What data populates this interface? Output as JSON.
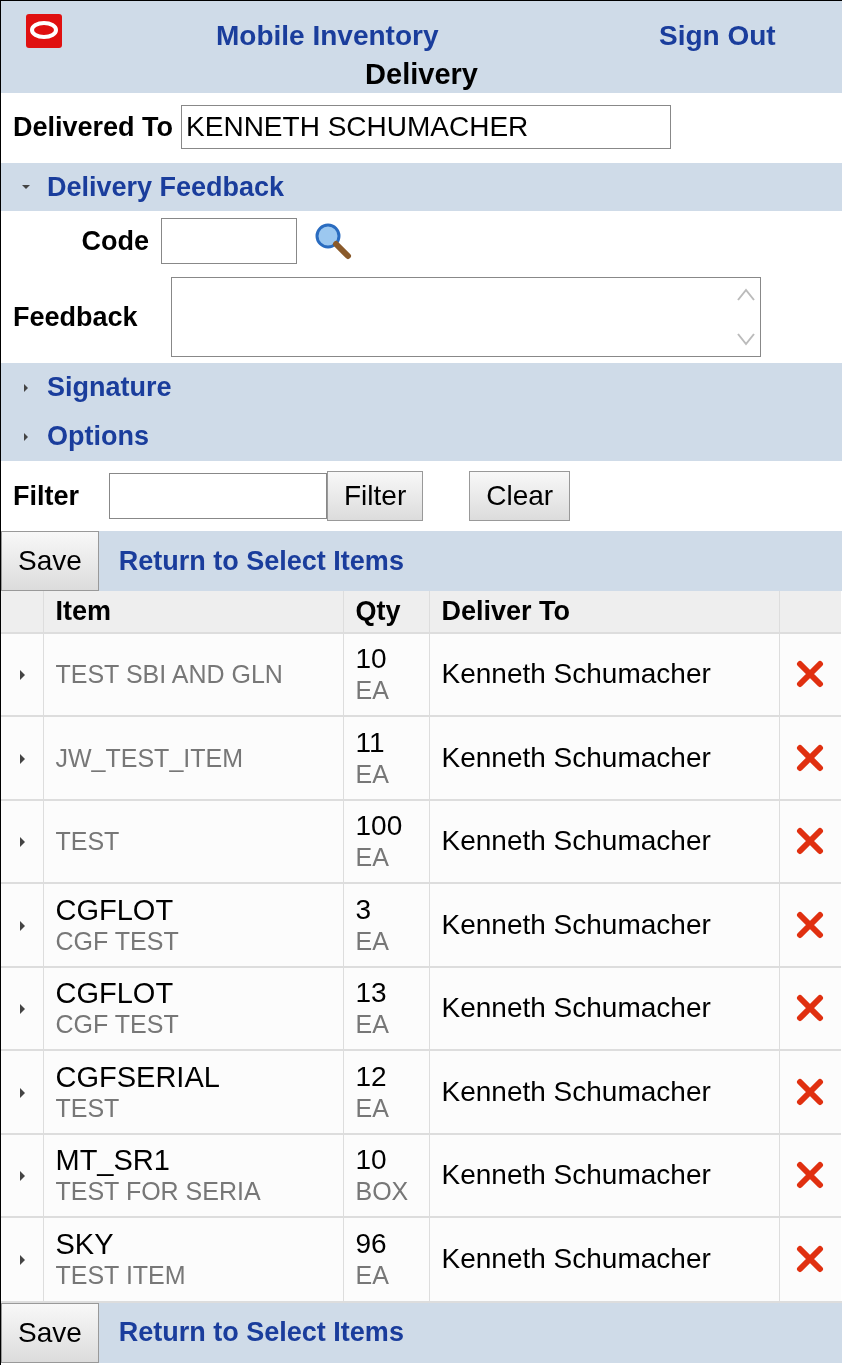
{
  "header": {
    "app_title": "Mobile Inventory",
    "sign_out": "Sign Out",
    "page_title": "Delivery"
  },
  "delivered_to": {
    "label": "Delivered To",
    "value": "KENNETH SCHUMACHER"
  },
  "sections": [
    {
      "title": "Delivery Feedback",
      "expanded": true,
      "fields": [
        {
          "kind": "lookup",
          "label": "Code"
        },
        {
          "kind": "textarea",
          "label": "Feedback"
        }
      ]
    },
    {
      "title": "Signature",
      "expanded": false
    },
    {
      "title": "Options",
      "expanded": false
    }
  ],
  "filter": {
    "label": "Filter",
    "buttons": [
      "Filter",
      "Clear"
    ]
  },
  "top_actions": {
    "save": "Save",
    "link": "Return to Select Items"
  },
  "table": {
    "columns": [
      "Item",
      "Qty",
      "Deliver To"
    ],
    "rows": [
      {
        "description": "TEST SBI AND GLN",
        "qty": "10",
        "uom": "EA",
        "deliver_to": "Kenneth Schumacher"
      },
      {
        "description": "JW_TEST_ITEM",
        "qty": "11",
        "uom": "EA",
        "deliver_to": "Kenneth Schumacher"
      },
      {
        "description": "TEST",
        "qty": "100",
        "uom": "EA",
        "deliver_to": "Kenneth Schumacher"
      },
      {
        "item": "CGFLOT",
        "description": "CGF TEST",
        "qty": "3",
        "uom": "EA",
        "deliver_to": "Kenneth Schumacher"
      },
      {
        "item": "CGFLOT",
        "description": "CGF TEST",
        "qty": "13",
        "uom": "EA",
        "deliver_to": "Kenneth Schumacher"
      },
      {
        "item": "CGFSERIAL",
        "description": "TEST",
        "qty": "12",
        "uom": "EA",
        "deliver_to": "Kenneth Schumacher"
      },
      {
        "item": "MT_SR1",
        "description": "TEST FOR SERIA",
        "qty": "10",
        "uom": "BOX",
        "deliver_to": "Kenneth Schumacher"
      },
      {
        "item": "SKY",
        "description": "TEST ITEM",
        "qty": "96",
        "uom": "EA",
        "deliver_to": "Kenneth Schumacher"
      }
    ]
  },
  "bottom_actions": {
    "save": "Save",
    "link": "Return to Select Items"
  }
}
